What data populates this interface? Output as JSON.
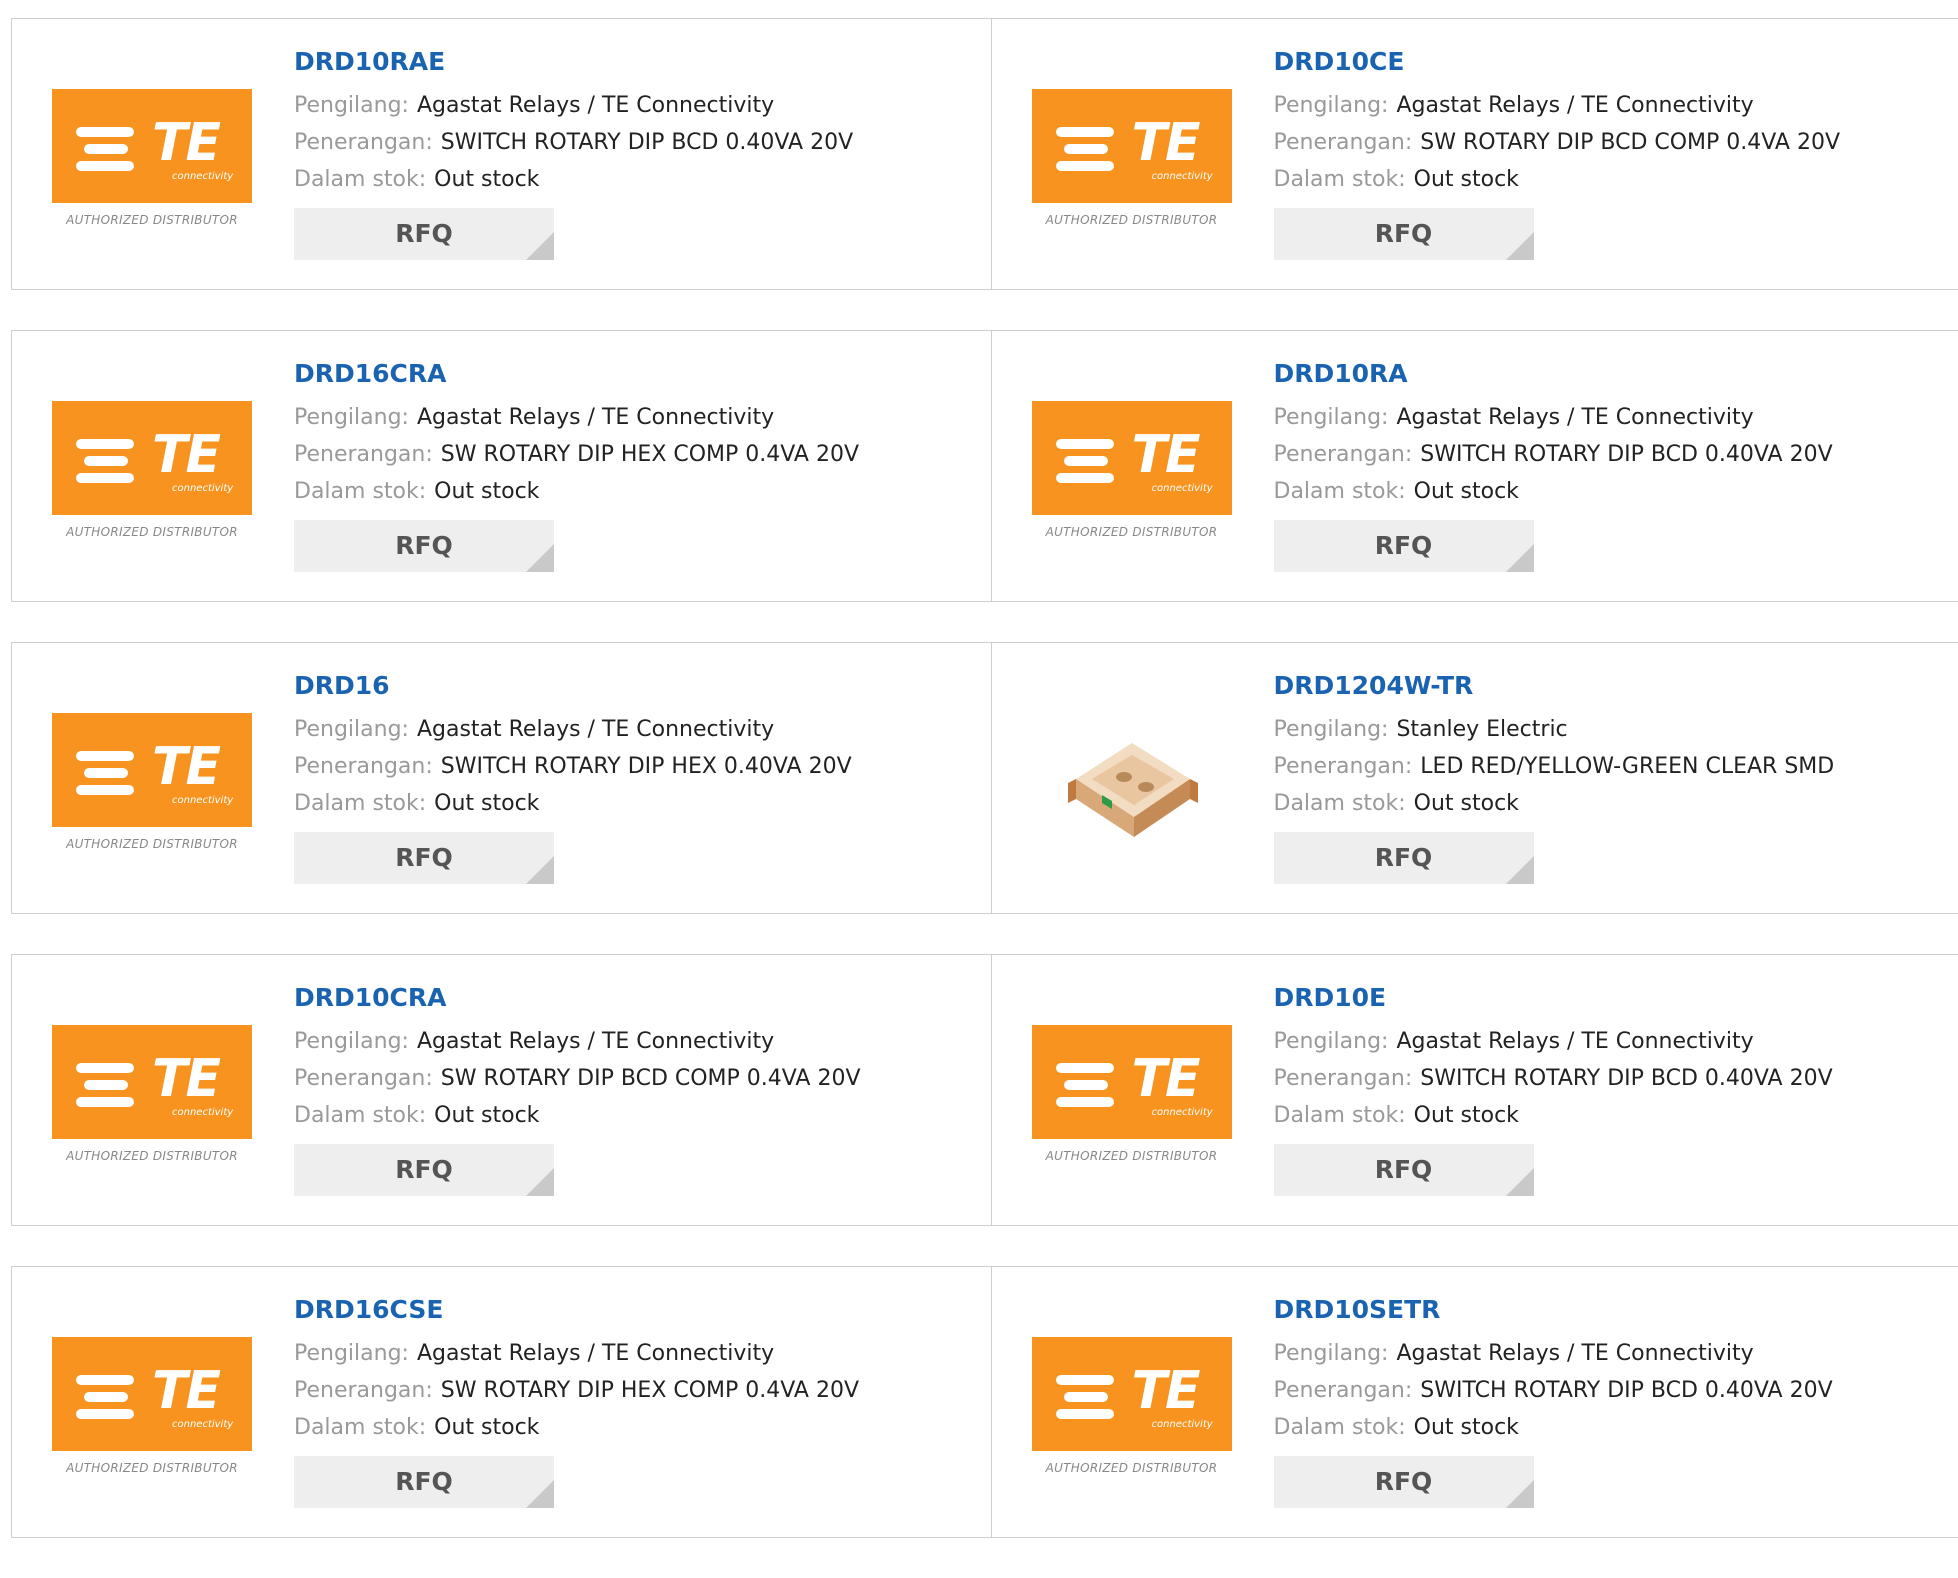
{
  "labels": {
    "manufacturer": "Pengilang:",
    "description": "Penerangan:",
    "stock": "Dalam stok:",
    "rfq": "RFQ",
    "authorized": "AUTHORIZED DISTRIBUTOR",
    "te_logo": "TE",
    "te_sub": "connectivity"
  },
  "colors": {
    "brand_orange": "#f7931e",
    "link_blue": "#1a63b0"
  },
  "products": [
    {
      "part": "DRD10RAE",
      "manufacturer": "Agastat Relays / TE Connectivity",
      "description": "SWITCH ROTARY DIP BCD 0.40VA 20V",
      "stock": "Out stock",
      "image": "te-logo"
    },
    {
      "part": "DRD10CE",
      "manufacturer": "Agastat Relays / TE Connectivity",
      "description": "SW ROTARY DIP BCD COMP 0.4VA 20V",
      "stock": "Out stock",
      "image": "te-logo"
    },
    {
      "part": "DRD16CRA",
      "manufacturer": "Agastat Relays / TE Connectivity",
      "description": "SW ROTARY DIP HEX COMP 0.4VA 20V",
      "stock": "Out stock",
      "image": "te-logo"
    },
    {
      "part": "DRD10RA",
      "manufacturer": "Agastat Relays / TE Connectivity",
      "description": "SWITCH ROTARY DIP BCD 0.40VA 20V",
      "stock": "Out stock",
      "image": "te-logo"
    },
    {
      "part": "DRD16",
      "manufacturer": "Agastat Relays / TE Connectivity",
      "description": "SWITCH ROTARY DIP HEX 0.40VA 20V",
      "stock": "Out stock",
      "image": "te-logo"
    },
    {
      "part": "DRD1204W-TR",
      "manufacturer": "Stanley Electric",
      "description": "LED RED/YELLOW-GREEN CLEAR SMD",
      "stock": "Out stock",
      "image": "led-photo"
    },
    {
      "part": "DRD10CRA",
      "manufacturer": "Agastat Relays / TE Connectivity",
      "description": "SW ROTARY DIP BCD COMP 0.4VA 20V",
      "stock": "Out stock",
      "image": "te-logo"
    },
    {
      "part": "DRD10E",
      "manufacturer": "Agastat Relays / TE Connectivity",
      "description": "SWITCH ROTARY DIP BCD 0.40VA 20V",
      "stock": "Out stock",
      "image": "te-logo"
    },
    {
      "part": "DRD16CSE",
      "manufacturer": "Agastat Relays / TE Connectivity",
      "description": "SW ROTARY DIP HEX COMP 0.4VA 20V",
      "stock": "Out stock",
      "image": "te-logo"
    },
    {
      "part": "DRD10SETR",
      "manufacturer": "Agastat Relays / TE Connectivity",
      "description": "SWITCH ROTARY DIP BCD 0.40VA 20V",
      "stock": "Out stock",
      "image": "te-logo"
    }
  ]
}
